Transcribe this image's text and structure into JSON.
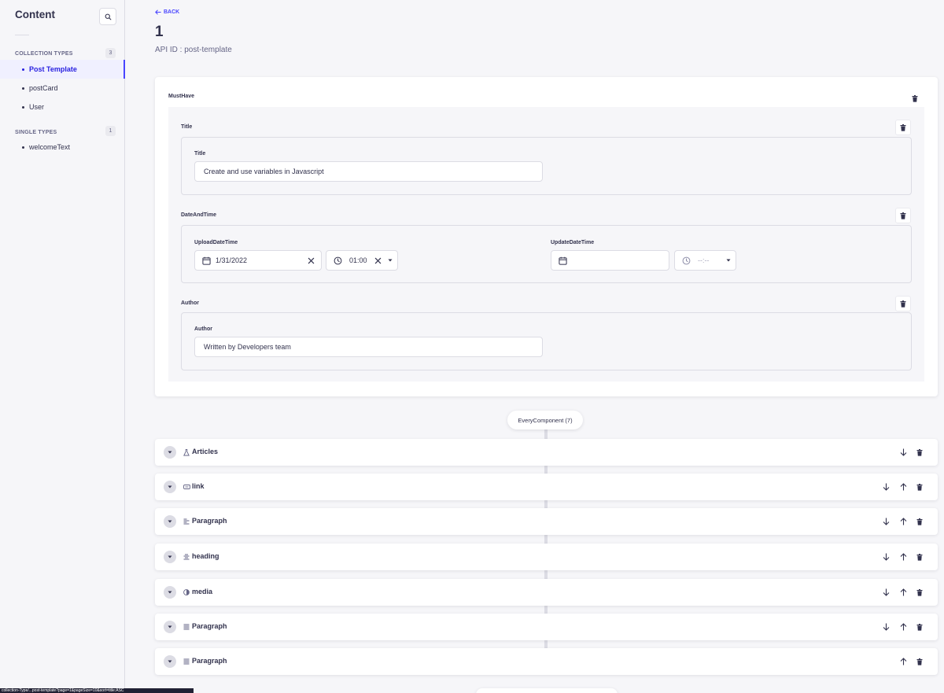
{
  "sidebar": {
    "title": "Content",
    "collection_types": {
      "label": "COLLECTION TYPES",
      "count": "3",
      "items": [
        {
          "label": "Post Template"
        },
        {
          "label": "postCard"
        },
        {
          "label": "User"
        }
      ]
    },
    "single_types": {
      "label": "SINGLE TYPES",
      "count": "1",
      "items": [
        {
          "label": "welcomeText"
        }
      ]
    }
  },
  "header": {
    "back_label": "BACK",
    "title": "1",
    "api_id": "API ID : post-template"
  },
  "mustHave": {
    "label": "MustHave",
    "title_component": {
      "label": "Title",
      "field_label": "Title",
      "value": "Create and use variables in Javascript"
    },
    "datetime_component": {
      "label": "DateAndTime",
      "upload": {
        "label": "UploadDateTime",
        "date": "1/31/2022",
        "time": "01:00"
      },
      "update": {
        "label": "UpdateDateTime",
        "date": "",
        "time": "--:--"
      }
    },
    "author_component": {
      "label": "Author",
      "field_label": "Author",
      "value": "Written by Developers team"
    }
  },
  "dynamic_zone": {
    "label": "EveryComponent (7)",
    "components": [
      {
        "name": "Articles",
        "icon": "flask-icon"
      },
      {
        "name": "link",
        "icon": "link-icon"
      },
      {
        "name": "Paragraph",
        "icon": "align-left-icon"
      },
      {
        "name": "heading",
        "icon": "align-center-icon"
      },
      {
        "name": "media",
        "icon": "contrast-icon"
      },
      {
        "name": "Paragraph",
        "icon": "align-justify-icon"
      },
      {
        "name": "Paragraph",
        "icon": "align-justify-icon"
      }
    ]
  },
  "status_bar": {
    "text": "collection-Type/...post-template?page=1&pageSize=10&sort=title:ASC"
  },
  "colors": {
    "primary": "#4945ff",
    "primary_dark": "#271fe0",
    "text": "#32324d",
    "muted": "#666687",
    "border": "#dcdce4",
    "background": "#f6f6f9"
  }
}
